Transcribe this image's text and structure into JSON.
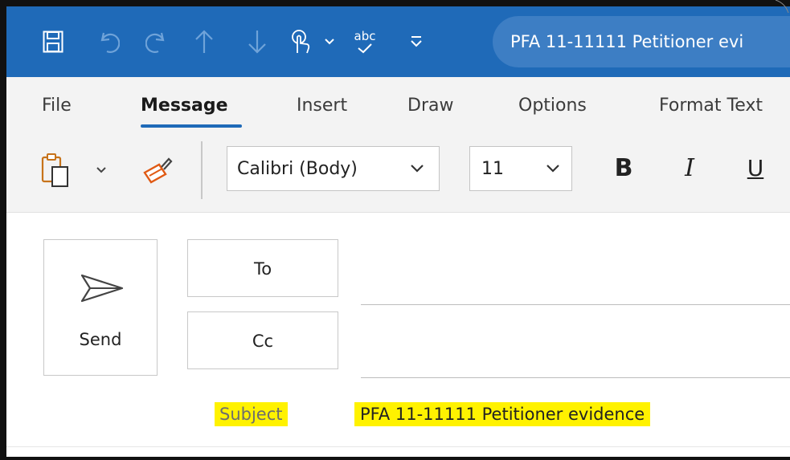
{
  "window": {
    "title": "PFA 11-11111 Petitioner evi"
  },
  "quick_access": {
    "save_icon": "save-icon",
    "undo_icon": "undo-icon",
    "redo_icon": "redo-icon",
    "up_icon": "arrow-up-icon",
    "down_icon": "arrow-down-icon",
    "touch_icon": "touch-mode-icon",
    "spelling_label": "abc",
    "customize_icon": "customize-toolbar-icon"
  },
  "menu": {
    "tabs": [
      {
        "label": "File",
        "active": false
      },
      {
        "label": "Message",
        "active": true
      },
      {
        "label": "Insert",
        "active": false
      },
      {
        "label": "Draw",
        "active": false
      },
      {
        "label": "Options",
        "active": false
      },
      {
        "label": "Format Text",
        "active": false
      }
    ]
  },
  "ribbon": {
    "paste_icon": "paste-icon",
    "format_painter_icon": "format-painter-icon",
    "font_name": "Calibri (Body)",
    "font_size": "11",
    "bold_label": "B",
    "italic_label": "I",
    "underline_label": "U"
  },
  "compose": {
    "send_label": "Send",
    "to_label": "To",
    "cc_label": "Cc",
    "to_value": "",
    "cc_value": "",
    "subject_label": "Subject",
    "subject_value": "PFA 11-11111 Petitioner evidence"
  },
  "colors": {
    "title_bar": "#1f6ab8",
    "accent": "#1f6ab8",
    "highlight": "#fff200",
    "ribbon_bg": "#f3f3f3"
  }
}
